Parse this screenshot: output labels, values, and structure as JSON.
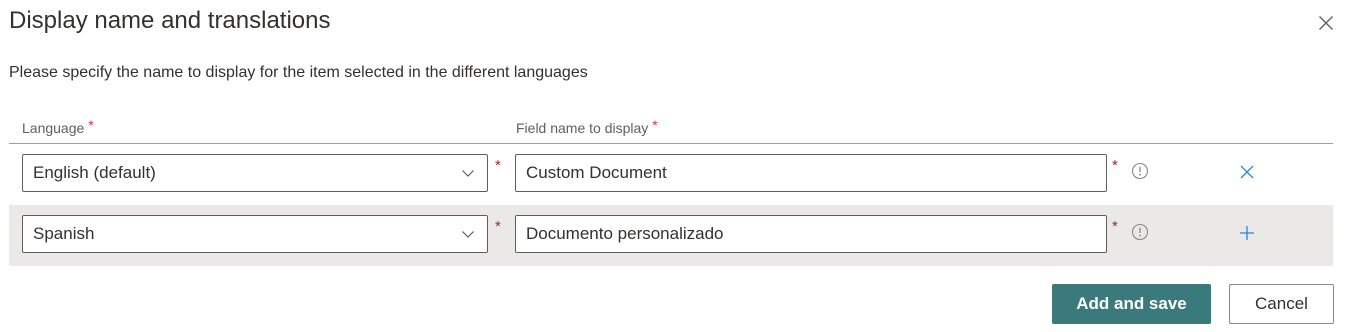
{
  "dialog": {
    "title": "Display name and translations",
    "description": "Please specify the name to display for the item selected in the different languages",
    "close_icon": "close-icon"
  },
  "columns": {
    "language": "Language",
    "field_name": "Field name to display",
    "required_marker": "*"
  },
  "rows": [
    {
      "language": "English (default)",
      "field_value": "Custom Document",
      "action_icon": "remove-icon"
    },
    {
      "language": "Spanish",
      "field_value": "Documento personalizado",
      "action_icon": "add-icon"
    }
  ],
  "footer": {
    "primary_label": "Add and save",
    "secondary_label": "Cancel"
  },
  "colors": {
    "primary": "#3a7a7c",
    "required": "#d13438",
    "row_highlight": "#ebe9e7",
    "icon_accent": "#2b88d8"
  }
}
